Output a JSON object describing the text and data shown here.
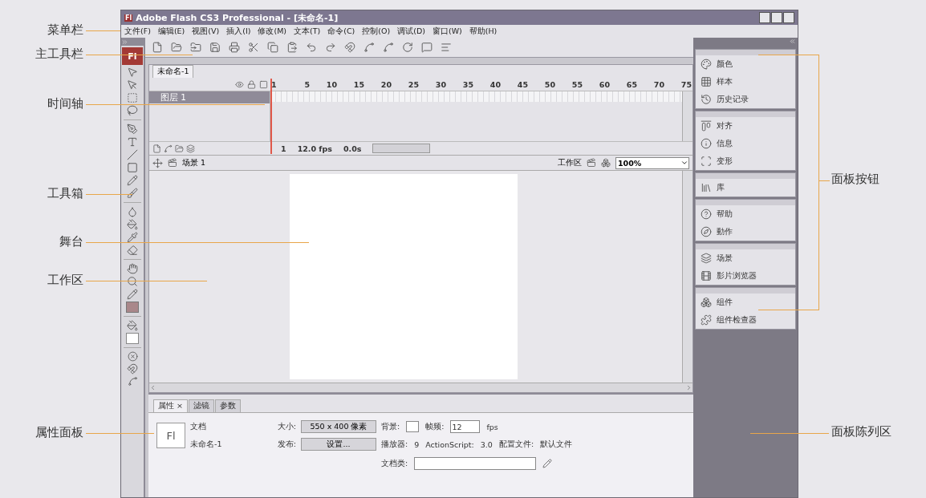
{
  "callouts_left": [
    "菜单栏",
    "主工具栏",
    "时间轴",
    "工具箱",
    "舞台",
    "工作区",
    "属性面板"
  ],
  "callouts_right": [
    "面板按钮",
    "面板陈列区"
  ],
  "window": {
    "app_icon": "Fl",
    "title": "Adobe Flash CS3 Professional - [未命名-1]"
  },
  "menu": [
    "文件(F)",
    "编辑(E)",
    "视图(V)",
    "插入(I)",
    "修改(M)",
    "文本(T)",
    "命令(C)",
    "控制(O)",
    "调试(D)",
    "窗口(W)",
    "帮助(H)"
  ],
  "toolbox": {
    "logo": "Fl"
  },
  "document_tab": "未命名-1",
  "timeline": {
    "frame_numbers": [
      "1",
      "5",
      "10",
      "15",
      "20",
      "25",
      "30",
      "35",
      "40",
      "45",
      "50",
      "55",
      "60",
      "65",
      "70",
      "75"
    ],
    "layers": [
      {
        "name": "图层 1",
        "selected": true
      }
    ],
    "current_frame": "1",
    "frame_rate": "12.0 fps",
    "elapsed": "0.0s"
  },
  "edit_bar": {
    "scene": "场景 1",
    "workspace": "工作区",
    "zoom": "100%"
  },
  "panel_groups": [
    {
      "items": [
        "颜色",
        "样本",
        "历史记录"
      ]
    },
    {
      "items": [
        "对齐",
        "信息",
        "变形"
      ]
    },
    {
      "items": [
        "库"
      ]
    },
    {
      "items": [
        "帮助",
        "動作"
      ]
    },
    {
      "items": [
        "场景",
        "影片浏览器"
      ]
    },
    {
      "items": [
        "组件",
        "组件检查器"
      ]
    }
  ],
  "properties": {
    "tabs": [
      {
        "label": "属性",
        "close": "×",
        "selected": true
      },
      {
        "label": "滤镜",
        "selected": false
      },
      {
        "label": "参数",
        "selected": false
      }
    ],
    "doc_icon": "Fl",
    "doc_type": "文档",
    "doc_name": "未命名-1",
    "size_label": "大小:",
    "size_button": "550 x 400 像素",
    "background_label": "背景:",
    "frame_rate_label": "帧频:",
    "frame_rate_value": "12",
    "fps_unit": "fps",
    "publish_label": "发布:",
    "settings_button": "设置...",
    "player_label": "播放器:",
    "player_value": "9",
    "actionscript_label": "ActionScript:",
    "actionscript_value": "3.0",
    "profile_label": "配置文件:",
    "profile_value": "默认文件",
    "doc_class_label": "文档类:"
  }
}
